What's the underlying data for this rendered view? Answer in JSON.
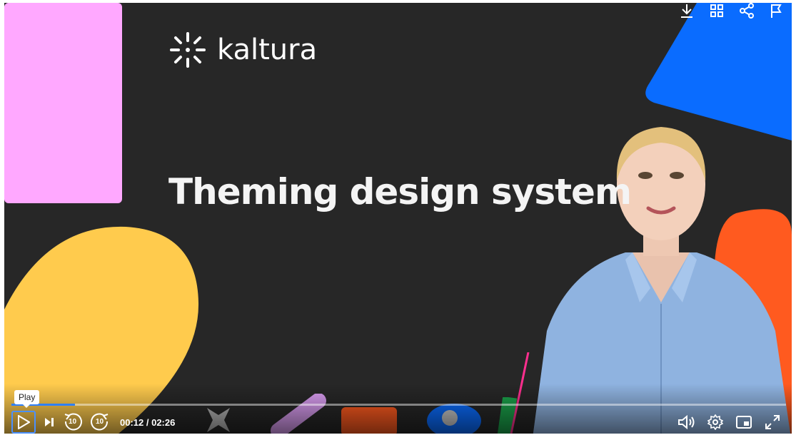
{
  "logo": {
    "text": "kaltura"
  },
  "video": {
    "headline": "Theming design system"
  },
  "player": {
    "progress_fraction": 0.082,
    "current_time": "00:12",
    "separator": " / ",
    "duration": "02:26",
    "tooltip": "Play",
    "rewind_seconds": "10",
    "forward_seconds": "10"
  },
  "icons": {
    "top": [
      "download-icon",
      "grid-icon",
      "share-icon",
      "flag-icon"
    ],
    "left": [
      "play-icon",
      "next-icon",
      "rewind-10-icon",
      "forward-10-icon"
    ],
    "right": [
      "volume-icon",
      "settings-icon",
      "picture-in-picture-icon",
      "fullscreen-icon"
    ]
  },
  "colors": {
    "background": "#272727",
    "pink": "#ffa8ff",
    "blue": "#0a6cff",
    "yellow": "#ffcb4d",
    "orange": "#ff5a1f",
    "accent": "#2f80ff"
  }
}
